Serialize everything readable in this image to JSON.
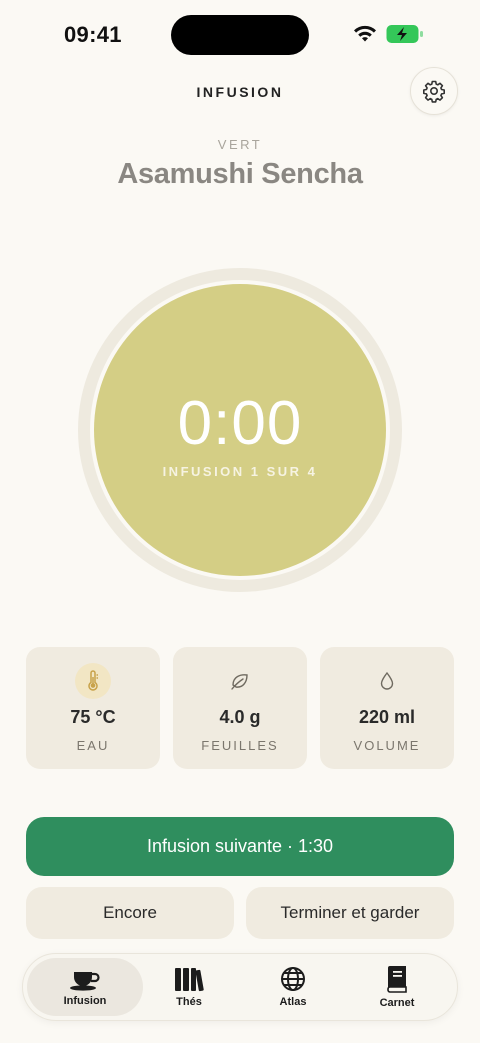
{
  "status_bar": {
    "time": "09:41",
    "icons": [
      "wifi-icon",
      "battery-charging-icon"
    ],
    "battery_color": "#34c759"
  },
  "header": {
    "title": "INFUSION",
    "settings_icon": "gear-icon"
  },
  "tea": {
    "category": "VERT",
    "name": "Asamushi Sencha"
  },
  "timer": {
    "value": "0:00",
    "subtitle": "INFUSION 1 SUR 4",
    "color": "#d4ce85"
  },
  "stats": [
    {
      "icon": "thermometer-icon",
      "value": "75 °C",
      "label": "EAU"
    },
    {
      "icon": "leaf-icon",
      "value": "4.0 g",
      "label": "FEUILLES"
    },
    {
      "icon": "droplet-icon",
      "value": "220 ml",
      "label": "VOLUME"
    }
  ],
  "actions": {
    "primary_label": "Infusion suivante · 1:30",
    "primary_color": "#2f8e5e",
    "again_label": "Encore",
    "finish_label": "Terminer et garder"
  },
  "tabs": [
    {
      "icon": "teacup-icon",
      "label": "Infusion",
      "active": true
    },
    {
      "icon": "books-icon",
      "label": "Thés",
      "active": false
    },
    {
      "icon": "globe-icon",
      "label": "Atlas",
      "active": false
    },
    {
      "icon": "notebook-icon",
      "label": "Carnet",
      "active": false
    }
  ]
}
